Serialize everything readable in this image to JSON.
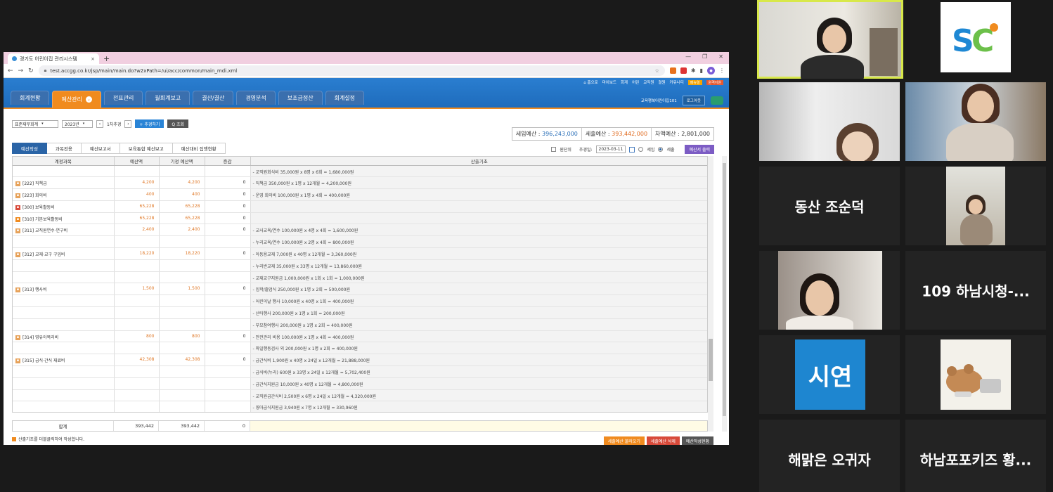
{
  "browser": {
    "tab_title": "경기도 어린이집 관리시스템",
    "tab_close": "×",
    "new_tab": "+",
    "url": "test.accgg.co.kr/jsp/main/main.do?w2xPath=/ui/acc/common/main_mdi.xml",
    "win_controls": [
      "—",
      "❐",
      "✕"
    ]
  },
  "app": {
    "util_links": [
      "⌂ 홈으로",
      "마이보드",
      "회계",
      "어린",
      "교직원",
      "결원",
      "커뮤니티"
    ],
    "util_badges": [
      "매뉴얼",
      "원격지원"
    ],
    "main_tabs": [
      "회계현황",
      "예산관리",
      "전표관리",
      "월회계보고",
      "결산/결산",
      "경영분석",
      "보조금정산",
      "회계설정"
    ],
    "active_tab_index": 1,
    "org_name": "교육행복어린이집101",
    "logout": "로그아웃"
  },
  "toolbar": {
    "account_type": "표준재무회계",
    "year": "2023년",
    "prev": "‹",
    "next": "›",
    "revision": "1차추경",
    "add_revision": "+ 추경하기",
    "search": "Q 조회"
  },
  "summary": {
    "income_label": "세입예산 :",
    "income_value": "396,243,000",
    "expense_label": "세출예산 :",
    "expense_value": "393,442,000",
    "diff_label": "차액예산 :",
    "diff_value": "2,801,000"
  },
  "subtabs": [
    "예산작성",
    "과목전용",
    "예산보고서",
    "보육통합 예산보고",
    "예산대비 집행현황"
  ],
  "active_subtab_index": 0,
  "subright": {
    "unit_label": "원단위",
    "date_label": "추경일:",
    "date_value": "2023-03-11",
    "radio_income": "세입",
    "radio_expense": "세출",
    "print_button": "예산서 출력"
  },
  "table": {
    "headers": [
      "계정과목",
      "예산액",
      "기정 예산액",
      "증감",
      "산출기초"
    ],
    "rows": [
      {
        "acct": "",
        "tag": "",
        "level": 0,
        "budget": "",
        "prior": "",
        "diff": "",
        "basis": "- 교직원회식비 35,000원 x 8명 x 6회 = 1,680,000원"
      },
      {
        "acct": "[222] 직책급",
        "tag": "tan",
        "level": 3,
        "budget": "4,200",
        "prior": "4,200",
        "diff": "0",
        "basis": "- 직책급 350,000원 x 1명 x 12개월 = 4,200,000원"
      },
      {
        "acct": "[223] 회의비",
        "tag": "tan",
        "level": 3,
        "budget": "400",
        "prior": "400",
        "diff": "0",
        "basis": "- 운영 회의비 100,000원 x 1명 x 4회 = 400,000원"
      },
      {
        "acct": "[300] 보육활동비",
        "tag": "red",
        "level": 1,
        "budget": "65,228",
        "prior": "65,228",
        "diff": "0",
        "basis": ""
      },
      {
        "acct": "[310] 기본보육활동비",
        "tag": "orange",
        "level": 2,
        "budget": "65,228",
        "prior": "65,228",
        "diff": "0",
        "basis": ""
      },
      {
        "acct": "[311] 교직원연수·연구비",
        "tag": "tan",
        "level": 3,
        "budget": "2,400",
        "prior": "2,400",
        "diff": "0",
        "basis": "- 교사교육/연수 100,000원 x 4명 x 4회 = 1,600,000원"
      },
      {
        "acct": "",
        "tag": "",
        "level": 0,
        "budget": "",
        "prior": "",
        "diff": "",
        "basis": "- 누리교육/연수 100,000원 x 2명 x 4회 = 800,000원"
      },
      {
        "acct": "[312] 교재·교구 구입비",
        "tag": "tan",
        "level": 3,
        "budget": "18,220",
        "prior": "18,220",
        "diff": "0",
        "basis": "- 아동용교재 7,000원 x 40명 x 12개월 = 3,360,000원"
      },
      {
        "acct": "",
        "tag": "",
        "level": 0,
        "budget": "",
        "prior": "",
        "diff": "",
        "basis": "- 누리반교재 35,000원 x 33명 x 12개월 = 13,860,000원"
      },
      {
        "acct": "",
        "tag": "",
        "level": 0,
        "budget": "",
        "prior": "",
        "diff": "",
        "basis": "- 교재교구지원금 1,000,000원 x 1회 x 1회 = 1,000,000원"
      },
      {
        "acct": "[313] 행사비",
        "tag": "tan",
        "level": 3,
        "budget": "1,500",
        "prior": "1,500",
        "diff": "0",
        "basis": "- 입학/졸업식 250,000원 x 1명 x 2회 = 500,000원"
      },
      {
        "acct": "",
        "tag": "",
        "level": 0,
        "budget": "",
        "prior": "",
        "diff": "",
        "basis": "- 어린이날 행사 10,000원 x 40명 x 1회 = 400,000원"
      },
      {
        "acct": "",
        "tag": "",
        "level": 0,
        "budget": "",
        "prior": "",
        "diff": "",
        "basis": "- 산타행사 200,000원 x 1명 x 1회 = 200,000원"
      },
      {
        "acct": "",
        "tag": "",
        "level": 0,
        "budget": "",
        "prior": "",
        "diff": "",
        "basis": "- 부모참여행사 200,000원 x 1명 x 2회 = 400,000원"
      },
      {
        "acct": "[314] 영유아복리비",
        "tag": "tan",
        "level": 3,
        "budget": "800",
        "prior": "800",
        "diff": "0",
        "basis": "- 안전관리 비용 100,000원 x 1명 x 4회 = 400,000원"
      },
      {
        "acct": "",
        "tag": "",
        "level": 0,
        "budget": "",
        "prior": "",
        "diff": "",
        "basis": "- 파일행동검사 외 200,000원 x 1명 x 2회 = 400,000원"
      },
      {
        "acct": "[315] 급식·간식 재료비",
        "tag": "tan",
        "level": 3,
        "budget": "42,308",
        "prior": "42,308",
        "diff": "0",
        "basis": "- 급간식비 1,900원 x 40명 x 24일 x 12개월 = 21,888,000원"
      },
      {
        "acct": "",
        "tag": "",
        "level": 0,
        "budget": "",
        "prior": "",
        "diff": "",
        "basis": "- 급식비(누리) 600원 x 33명 x 24일 x 12개월 = 5,702,400원"
      },
      {
        "acct": "",
        "tag": "",
        "level": 0,
        "budget": "",
        "prior": "",
        "diff": "",
        "basis": "- 급간식지원금 10,000원 x 40명 x 12개월 = 4,800,000원"
      },
      {
        "acct": "",
        "tag": "",
        "level": 0,
        "budget": "",
        "prior": "",
        "diff": "",
        "basis": "- 교직원급간식비 2,500원 x 6명 x 24일 x 12개월 = 4,320,000원"
      },
      {
        "acct": "",
        "tag": "",
        "level": 0,
        "budget": "",
        "prior": "",
        "diff": "",
        "basis": "- 영아급식지원금 3,940원 x 7명 x 12개월 = 330,960원"
      }
    ],
    "total_label": "합계",
    "total_budget": "393,442",
    "total_prior": "393,442",
    "total_diff": "0"
  },
  "footer": {
    "note": "산출기초를 더블클릭하여 작성합니다.",
    "buttons": [
      "세출예산 불러오기",
      "세출예산 삭제",
      "예산작성현황"
    ]
  },
  "participants": {
    "name_1": "동산 조순덕",
    "name_2": "109 하남시청-...",
    "name_3": "시연",
    "name_4": "해맑은 오귀자",
    "name_5": "하남포포키즈 황..."
  },
  "colors": {
    "app_blue": "#1e6bbb",
    "active_orange": "#f08b1f",
    "income_blue": "#2a6fb8",
    "expense_orange": "#e06a1e",
    "speaker_highlight": "#d8e84a",
    "sion_tile": "#1e86d0"
  }
}
